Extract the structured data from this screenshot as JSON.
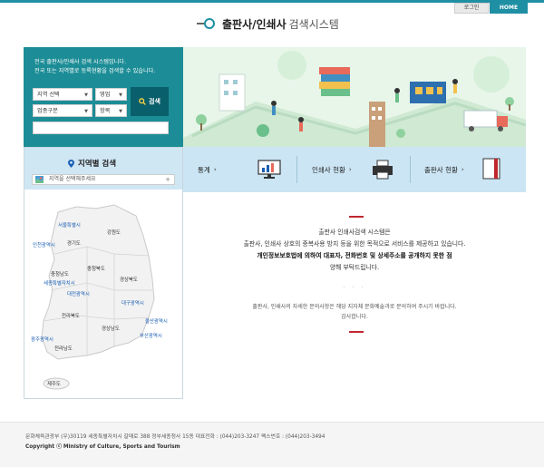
{
  "header": {
    "login_label": "로그인",
    "home_label": "HOME",
    "title_bold": "출판사/인쇄사",
    "title_rest": "검색시스템"
  },
  "search": {
    "desc_line1": "전국 출판사/인쇄사 검색 시스템입니다.",
    "desc_line2": "전국 또는 지역별로 등록현황을 검색할 수 있습니다.",
    "region_select": "지역 선택",
    "business_select": "영업",
    "industry_select": "업종구분",
    "item_select": "항목",
    "search_button": "검색",
    "input_value": ""
  },
  "region": {
    "title": "지역별 검색",
    "select_placeholder": "지역을 선택해주세요",
    "map_labels": [
      {
        "name": "seoul",
        "text": "서울특별시",
        "blue": true
      },
      {
        "name": "incheon",
        "text": "인천광역시",
        "blue": true
      },
      {
        "name": "gyeonggi",
        "text": "경기도",
        "blue": false
      },
      {
        "name": "gangwon",
        "text": "강원도",
        "blue": false
      },
      {
        "name": "chungnam",
        "text": "충청남도",
        "blue": false
      },
      {
        "name": "chungbuk",
        "text": "충청북도",
        "blue": false
      },
      {
        "name": "sejong",
        "text": "세종특별자치시",
        "blue": true
      },
      {
        "name": "daejeon",
        "text": "대전광역시",
        "blue": true
      },
      {
        "name": "gyeongbuk",
        "text": "경상북도",
        "blue": false
      },
      {
        "name": "daegu",
        "text": "대구광역시",
        "blue": true
      },
      {
        "name": "jeonbuk",
        "text": "전라북도",
        "blue": false
      },
      {
        "name": "ulsan",
        "text": "울산광역시",
        "blue": true
      },
      {
        "name": "gyeongnam",
        "text": "경상남도",
        "blue": false
      },
      {
        "name": "gwangju",
        "text": "광주광역시",
        "blue": true
      },
      {
        "name": "busan",
        "text": "부산광역시",
        "blue": true
      },
      {
        "name": "jeonnam",
        "text": "전라남도",
        "blue": false
      },
      {
        "name": "jeju",
        "text": "제주도",
        "blue": false
      }
    ]
  },
  "nav": {
    "stats": "통계",
    "printer_status": "인쇄사 현황",
    "publisher_status": "출판사 현황"
  },
  "notice": {
    "line1": "출판사 인쇄사검색 시스템은",
    "line2": "출판사, 인쇄사 상호의 중복사용 방지 등을 위한 목적으로 서비스를 제공하고 있습니다.",
    "line3": "개인정보보호법에 의하여 대표자, 전화번호 및 상세주소를 공개하지 못한 점",
    "line4": "양해 부탁드립니다.",
    "dots": "· · ·",
    "small1": "출판사, 인쇄사의 자세한 문의사항은 해당 지자체 문화예술과로 문의하여 주시기 바랍니다.",
    "small2": "감사합니다."
  },
  "footer": {
    "line1": "문화체육관광부 (우)30119 세종특별자치시 갈매로 388 정부세종청사 15동 대표전화 : (044)203-3247 팩스번호 : (044)203-3494",
    "line2": "Copyright ⓒ Ministry of Culture, Sports and Tourism"
  },
  "colors": {
    "teal": "#1c8d96",
    "dark_teal": "#095f6b",
    "light_blue": "#cbe5f4",
    "red": "#c0262f"
  }
}
